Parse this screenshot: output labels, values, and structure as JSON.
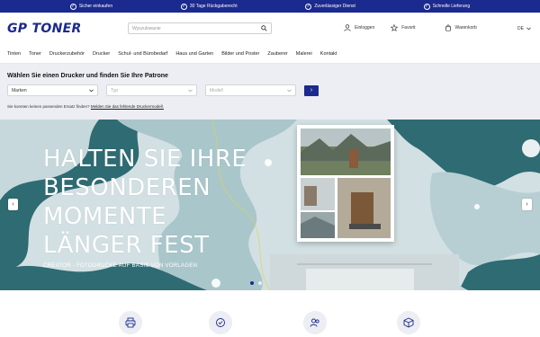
{
  "topbar": {
    "items": [
      {
        "icon": "check-circle-icon",
        "label": "Sicher einkaufen"
      },
      {
        "icon": "check-circle-icon",
        "label": "30 Tage Rückgaberecht"
      },
      {
        "icon": "check-circle-icon",
        "label": "Zuverlässiger Dienst"
      },
      {
        "icon": "check-circle-icon",
        "label": "Schnelle Lieferung"
      }
    ]
  },
  "header": {
    "logo": "GP TONER",
    "search_placeholder": "Wyszukiwanie",
    "login_label": "Einloggen",
    "favorites_label": "Favorit",
    "cart_label": "Warenkorb",
    "language": "DE"
  },
  "nav": {
    "items": [
      "Tinten",
      "Toner",
      "Druckerzubehör",
      "Drucker",
      "Schul- und Bürobedarf",
      "Haus und Garten",
      "Bilder und Poster",
      "Zauberer",
      "Malerei",
      "Kontakt"
    ]
  },
  "finder": {
    "title": "Wählen Sie einen Drucker und finden Sie Ihre Patrone",
    "manufacturer": "Marken",
    "type": "Typ",
    "model": "Modell",
    "hint_text": "Sie konnten keinen passenden Ersatz finden?",
    "hint_link": "Melden Sie das fehlende Druckermodell."
  },
  "hero": {
    "title_lines": [
      "HALTEN SIE IHRE",
      "BESONDEREN",
      "MOMENTE",
      "LÄNGER FEST"
    ],
    "subtitle": "CREATOR - FOTODRUCKE AUF BASIS VON VORLAGEN",
    "colors": {
      "teal": "#2e6b73",
      "light": "#c9d9dc",
      "bg": "#d7e3e6"
    }
  },
  "features": {
    "icons": [
      "printer-icon",
      "badge-check-icon",
      "users-icon",
      "box-icon"
    ]
  }
}
